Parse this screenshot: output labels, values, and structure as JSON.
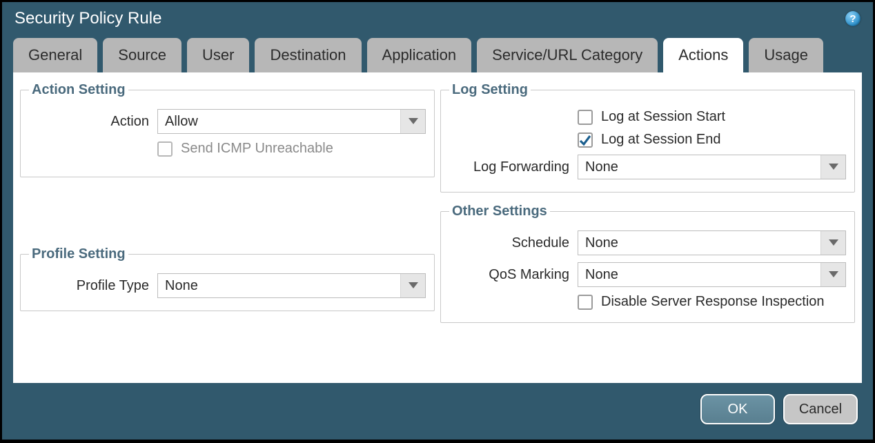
{
  "title": "Security Policy Rule",
  "tabs": [
    {
      "label": "General"
    },
    {
      "label": "Source"
    },
    {
      "label": "User"
    },
    {
      "label": "Destination"
    },
    {
      "label": "Application"
    },
    {
      "label": "Service/URL Category"
    },
    {
      "label": "Actions"
    },
    {
      "label": "Usage"
    }
  ],
  "active_tab_index": 6,
  "action_setting": {
    "legend": "Action Setting",
    "action_label": "Action",
    "action_value": "Allow",
    "send_icmp_label": "Send ICMP Unreachable",
    "send_icmp_checked": false
  },
  "profile_setting": {
    "legend": "Profile Setting",
    "profile_type_label": "Profile Type",
    "profile_type_value": "None"
  },
  "log_setting": {
    "legend": "Log Setting",
    "log_start_label": "Log at Session Start",
    "log_start_checked": false,
    "log_end_label": "Log at Session End",
    "log_end_checked": true,
    "log_forwarding_label": "Log Forwarding",
    "log_forwarding_value": "None"
  },
  "other_settings": {
    "legend": "Other Settings",
    "schedule_label": "Schedule",
    "schedule_value": "None",
    "qos_label": "QoS Marking",
    "qos_value": "None",
    "disable_inspection_label": "Disable Server Response Inspection",
    "disable_inspection_checked": false
  },
  "buttons": {
    "ok": "OK",
    "cancel": "Cancel"
  }
}
